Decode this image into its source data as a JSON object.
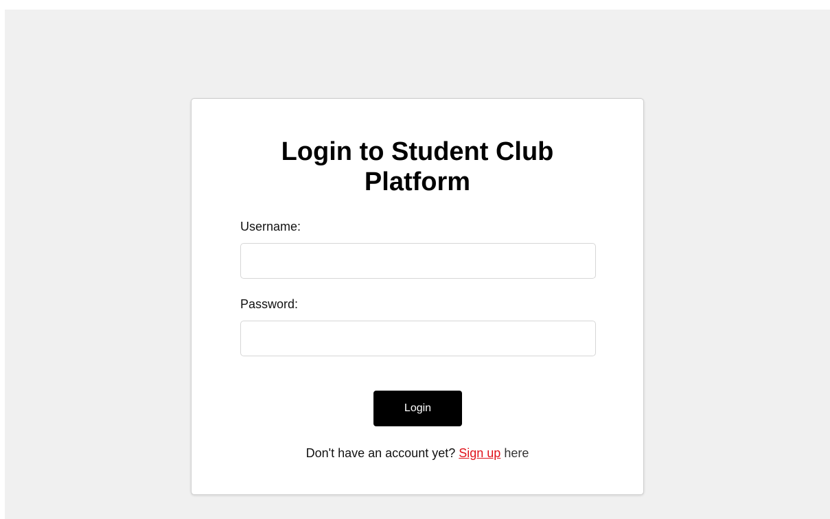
{
  "login": {
    "title": "Login to Student Club Platform",
    "username_label": "Username:",
    "username_value": "",
    "password_label": "Password:",
    "password_value": "",
    "button_label": "Login",
    "signup_prompt": "Don't have an account yet?",
    "signup_link": "Sign up",
    "signup_suffix": "here"
  },
  "colors": {
    "page_background": "#f0f0f0",
    "card_background": "#ffffff",
    "button_background": "#000000",
    "link": "#e0121b"
  }
}
